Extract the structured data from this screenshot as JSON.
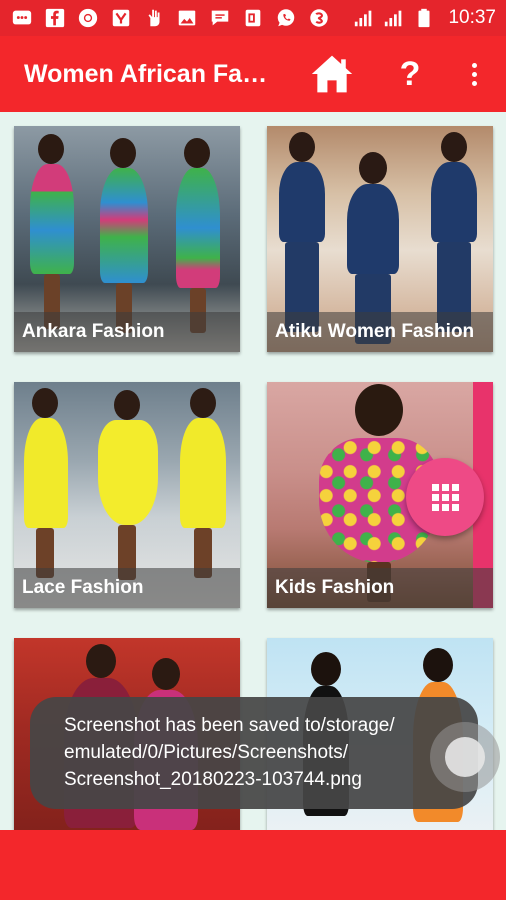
{
  "status_bar": {
    "time": "10:37",
    "notification_icons": [
      "messages-icon",
      "facebook-icon",
      "chrome-icon",
      "yahoo-icon",
      "hand-icon",
      "gallery-icon",
      "chat-icon",
      "office-icon",
      "whatsapp-icon",
      "app-icon"
    ],
    "system_icons": [
      "signal-icon",
      "signal-icon-2",
      "battery-icon"
    ]
  },
  "app_bar": {
    "title": "Women African Fa…",
    "home_icon": "home-icon",
    "help_label": "?",
    "more_icon": "more-vert-icon"
  },
  "categories": [
    {
      "label": "Ankara Fashion"
    },
    {
      "label": "Atiku Women Fashion"
    },
    {
      "label": "Lace Fashion"
    },
    {
      "label": "Kids Fashion"
    },
    {
      "label": ""
    },
    {
      "label": ""
    }
  ],
  "fab": {
    "icon": "apps-grid-icon"
  },
  "toast": {
    "lines": [
      "Screenshot has been saved to/storage/",
      "emulated/0/Pictures/Screenshots/",
      "Screenshot_20180223-103744.png"
    ]
  },
  "colors": {
    "primary": "#f3272b",
    "status_bar": "#e5252c",
    "background": "#e6f4ef",
    "fab": "#ee4a86"
  }
}
